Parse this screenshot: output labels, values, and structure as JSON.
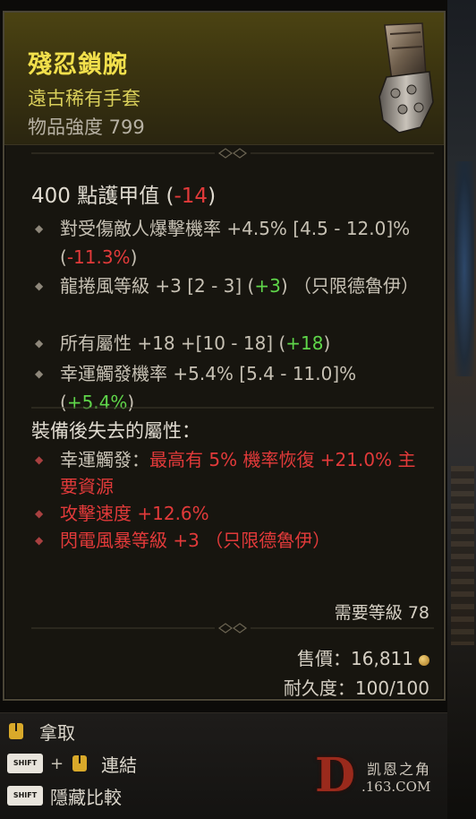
{
  "item": {
    "name": "殘忍鎖腕",
    "type": "遠古稀有手套",
    "power": "物品強度 799"
  },
  "armor": {
    "value": "400 點護甲值 (",
    "delta": "-14",
    "close": ")"
  },
  "affixes": [
    {
      "text": "對受傷敵人爆擊機率 +4.5% [4.5 - 12.0]% (",
      "delta": "-11.3%",
      "delta_class": "neg",
      "close": ")"
    },
    {
      "text": "龍捲風等級 +3 [2 - 3] (",
      "delta": "+3",
      "delta_class": "pos",
      "close": ") （只限德魯伊）"
    },
    {
      "text": "所有屬性 +18 +[10 - 18] (",
      "delta": "+18",
      "delta_class": "pos",
      "close": ")"
    },
    {
      "text": "幸運觸發機率 +5.4% [5.4 - 11.0]% (",
      "delta": "+5.4%",
      "delta_class": "pos",
      "close": ")"
    }
  ],
  "lost": {
    "title": "裝備後失去的屬性：",
    "items": [
      {
        "prefix": "幸運觸發：",
        "text": "最高有 5% 機率恢復 +21.0% 主要資源"
      },
      {
        "prefix": "",
        "text": "攻擊速度 +12.6%"
      },
      {
        "prefix": "",
        "text": "閃電風暴等級 +3 （只限德魯伊）"
      }
    ]
  },
  "requirements": {
    "level": "需要等級 78",
    "price_label": "售價：16,811",
    "durability": "耐久度：100/100"
  },
  "actions": {
    "take": "拿取",
    "link": "連結",
    "hide_compare": "隱藏比較",
    "shift_label": "SHIFT",
    "plus": "+"
  },
  "watermark": {
    "letter": "D",
    "site_name": "凯恩之角",
    "url": ".163.COM"
  },
  "colors": {
    "title": "#f2e04c",
    "positive": "#5fd64a",
    "negative": "#e23a3a"
  }
}
